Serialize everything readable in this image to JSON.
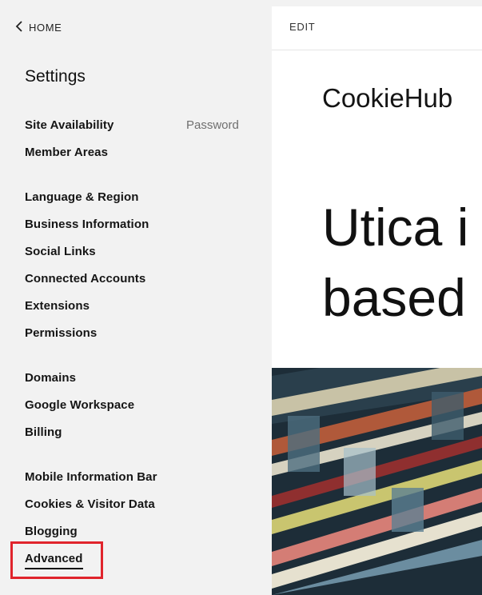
{
  "sidebar": {
    "home_label": "HOME",
    "title": "Settings",
    "items": [
      {
        "label": "Site Availability",
        "meta": "Password"
      },
      {
        "label": "Member Areas"
      },
      {
        "label": "Language & Region"
      },
      {
        "label": "Business Information"
      },
      {
        "label": "Social Links"
      },
      {
        "label": "Connected Accounts"
      },
      {
        "label": "Extensions"
      },
      {
        "label": "Permissions"
      },
      {
        "label": "Domains"
      },
      {
        "label": "Google Workspace"
      },
      {
        "label": "Billing"
      },
      {
        "label": "Mobile Information Bar"
      },
      {
        "label": "Cookies & Visitor Data"
      },
      {
        "label": "Blogging"
      },
      {
        "label": "Advanced"
      }
    ]
  },
  "preview": {
    "edit_label": "EDIT",
    "brand": "CookieHub",
    "hero_line1": "Utica i",
    "hero_line2": "based"
  },
  "colors": {
    "highlight": "#e0242c",
    "sidebar_bg": "#f2f2f2",
    "preview_bg": "#ffffff"
  }
}
